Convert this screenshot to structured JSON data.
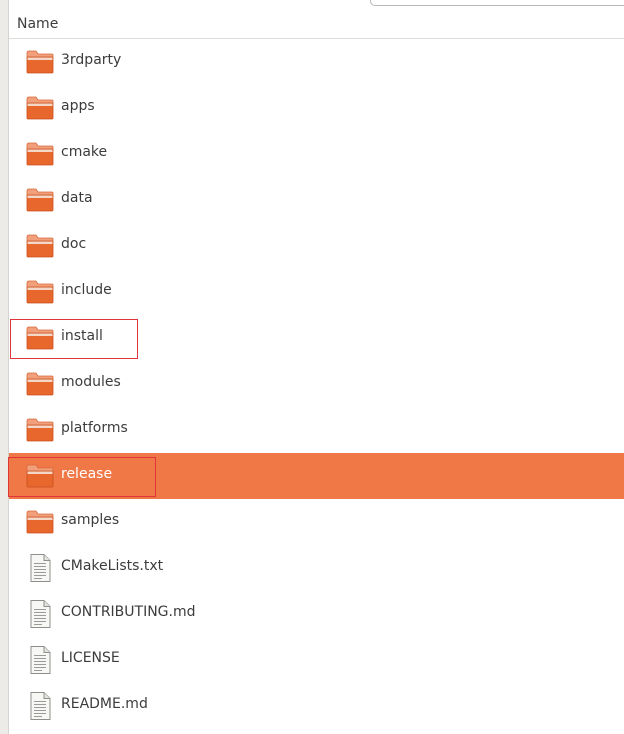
{
  "header": {
    "column_name": "Name"
  },
  "files": [
    {
      "name": "3rdparty",
      "kind": "folder",
      "icon": "folder-icon"
    },
    {
      "name": "apps",
      "kind": "folder",
      "icon": "folder-icon"
    },
    {
      "name": "cmake",
      "kind": "folder",
      "icon": "folder-icon"
    },
    {
      "name": "data",
      "kind": "folder",
      "icon": "folder-icon"
    },
    {
      "name": "doc",
      "kind": "folder",
      "icon": "folder-icon"
    },
    {
      "name": "include",
      "kind": "folder",
      "icon": "folder-icon"
    },
    {
      "name": "install",
      "kind": "folder",
      "icon": "folder-icon",
      "annotated": true
    },
    {
      "name": "modules",
      "kind": "folder",
      "icon": "folder-icon"
    },
    {
      "name": "platforms",
      "kind": "folder",
      "icon": "folder-icon"
    },
    {
      "name": "release",
      "kind": "folder",
      "icon": "folder-icon",
      "selected": true,
      "annotated": true
    },
    {
      "name": "samples",
      "kind": "folder",
      "icon": "folder-icon"
    },
    {
      "name": "CMakeLists.txt",
      "kind": "file",
      "icon": "text-file-icon"
    },
    {
      "name": "CONTRIBUTING.md",
      "kind": "file",
      "icon": "text-file-icon"
    },
    {
      "name": "LICENSE",
      "kind": "file",
      "icon": "text-file-icon"
    },
    {
      "name": "README.md",
      "kind": "file",
      "icon": "text-file-icon"
    }
  ],
  "colors": {
    "selection": "#f07746",
    "folder_body": "#e8672c",
    "folder_tab": "#f2a07c",
    "annotation": "#e0353a",
    "text": "#3c3c3c"
  }
}
